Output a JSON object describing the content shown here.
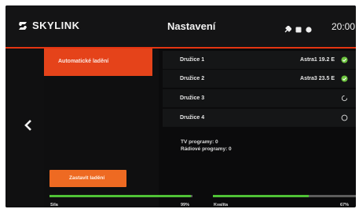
{
  "header": {
    "brand": "SKYLINK",
    "title": "Nastavení",
    "clock": "20:00",
    "accent_color": "#e53512"
  },
  "menu": {
    "active_item": "Automatické ladění"
  },
  "satellites": [
    {
      "name": "Družice 1",
      "value": "Astra1 19.2 E",
      "status": "check-circle-icon"
    },
    {
      "name": "Družice 2",
      "value": "Astra3 23.5 E",
      "status": "check-circle-icon"
    },
    {
      "name": "Družice 3",
      "value": "",
      "status": "loading-spinner-icon"
    },
    {
      "name": "Družice 4",
      "value": "",
      "status": "empty-circle-icon"
    }
  ],
  "results": {
    "tv_programs": "TV programy: 0",
    "radio_programs": "Rádiové programy: 0"
  },
  "stop_button": "Zastavit ladění",
  "meters": {
    "signal": {
      "label": "Síla",
      "value": "99%",
      "fraction": 0.99,
      "color": "#4fc236"
    },
    "quality": {
      "label": "Kvalita",
      "value": "67%",
      "fraction": 0.67,
      "color": "#4fc236"
    }
  }
}
